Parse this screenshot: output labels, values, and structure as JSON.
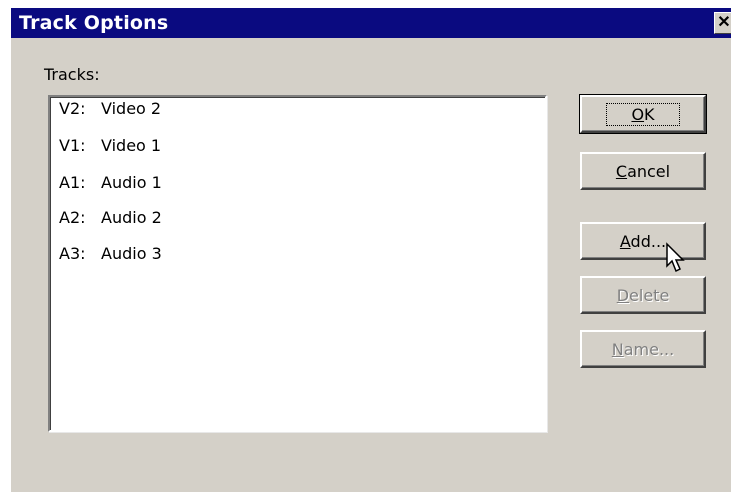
{
  "window": {
    "title": "Track Options",
    "close_glyph": "✕"
  },
  "tracks_label": "Tracks:",
  "tracks": [
    {
      "code": "V2:",
      "name": "Video 2"
    },
    {
      "code": "V1:",
      "name": "Video 1"
    },
    {
      "code": "A1:",
      "name": "Audio 1"
    },
    {
      "code": "A2:",
      "name": "Audio 2"
    },
    {
      "code": "A3:",
      "name": "Audio 3"
    }
  ],
  "buttons": {
    "ok": {
      "mnemonic": "O",
      "rest": "K",
      "enabled": true
    },
    "cancel": {
      "mnemonic": "C",
      "rest": "ancel",
      "enabled": true
    },
    "add": {
      "mnemonic": "A",
      "rest": "dd...",
      "enabled": true
    },
    "delete": {
      "mnemonic": "D",
      "rest": "elete",
      "enabled": false
    },
    "name": {
      "mnemonic": "N",
      "rest": "ame...",
      "enabled": false
    }
  },
  "colors": {
    "titlebar": "#0a0a80",
    "dialog_face": "#d4d0c8",
    "disabled_text": "#808080"
  },
  "icons": {
    "close": "close-icon",
    "cursor": "mouse-pointer-icon"
  }
}
